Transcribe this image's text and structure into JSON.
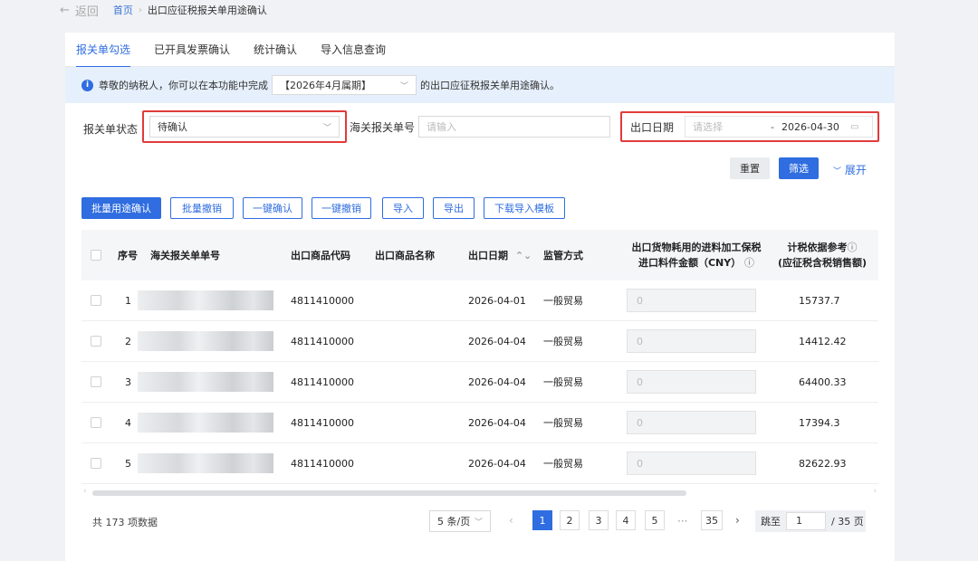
{
  "topbar": {
    "back_label": "返回",
    "crumb_home": "首页",
    "crumb_current": "出口应征税报关单用途确认"
  },
  "tabs": [
    {
      "label": "报关单勾选",
      "active": true
    },
    {
      "label": "已开具发票确认"
    },
    {
      "label": "统计确认"
    },
    {
      "label": "导入信息查询"
    }
  ],
  "notice": {
    "prefix": "尊敬的纳税人，你可以在本功能中完成",
    "period": "【2026年4月属期】",
    "suffix": "的出口应征税报关单用途确认。"
  },
  "filters": {
    "status_label": "报关单状态",
    "status_value": "待确认",
    "customs_no_label": "海关报关单号",
    "customs_no_placeholder": "请输入",
    "date_label": "出口日期",
    "date_start_placeholder": "请选择",
    "date_sep": "-",
    "date_end": "2026-04-30",
    "reset": "重置",
    "filter": "筛选",
    "expand": "展开"
  },
  "actions": [
    "批量用途确认",
    "批量撤销",
    "一键确认",
    "一键撤销",
    "导入",
    "导出",
    "下载导入模板"
  ],
  "table": {
    "headers": {
      "index": "序号",
      "customs_no": "海关报关单单号",
      "goods_code": "出口商品代码",
      "goods_name": "出口商品名称",
      "export_date": "出口日期",
      "supervision": "监管方式",
      "amount_line1": "出口货物耗用的进料加工保税",
      "amount_line2": "进口料件金额（CNY）",
      "tax_line1": "计税依据参考",
      "tax_line2": "(应征税含税销售额)"
    },
    "rows": [
      {
        "index": "1",
        "goods_code": "4811410000",
        "goods_name": "",
        "export_date": "2026-04-01",
        "supervision": "一般贸易",
        "amount": "0",
        "tax_basis": "15737.7"
      },
      {
        "index": "2",
        "goods_code": "4811410000",
        "goods_name": "",
        "export_date": "2026-04-04",
        "supervision": "一般贸易",
        "amount": "0",
        "tax_basis": "14412.42"
      },
      {
        "index": "3",
        "goods_code": "4811410000",
        "goods_name": "",
        "export_date": "2026-04-04",
        "supervision": "一般贸易",
        "amount": "0",
        "tax_basis": "64400.33"
      },
      {
        "index": "4",
        "goods_code": "4811410000",
        "goods_name": "",
        "export_date": "2026-04-04",
        "supervision": "一般贸易",
        "amount": "0",
        "tax_basis": "17394.3"
      },
      {
        "index": "5",
        "goods_code": "4811410000",
        "goods_name": "",
        "export_date": "2026-04-04",
        "supervision": "一般贸易",
        "amount": "0",
        "tax_basis": "82622.93"
      }
    ]
  },
  "pagination": {
    "total": "共 173 项数据",
    "page_size": "5 条/页",
    "pages": [
      "1",
      "2",
      "3",
      "4",
      "5"
    ],
    "ellipsis": "···",
    "last": "35",
    "jump_label": "跳至",
    "jump_value": "1",
    "jump_suffix": "/ 35 页"
  },
  "colors": {
    "primary": "#2f6de0",
    "highlight": "#e23b3b",
    "notice_bg": "#e6f0fc"
  }
}
